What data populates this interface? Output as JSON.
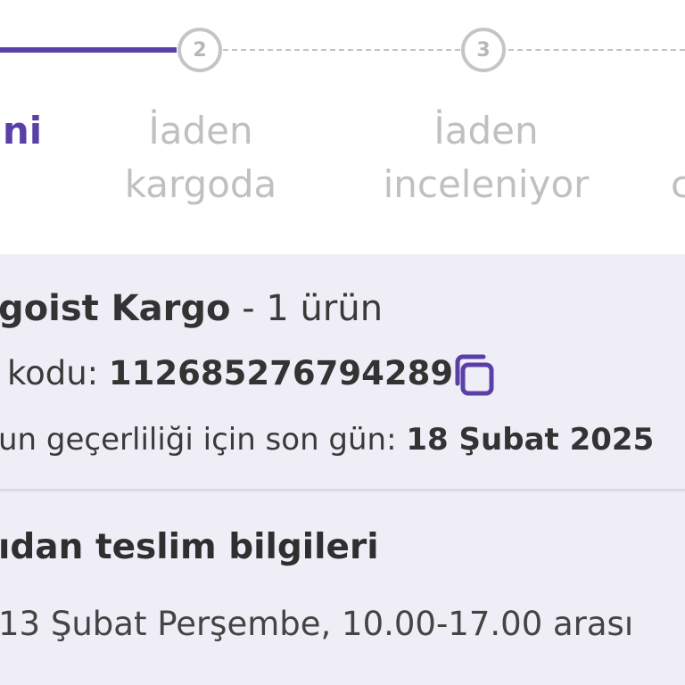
{
  "stepper": {
    "steps": [
      {
        "number": "",
        "label_lines": [
          "ni",
          ""
        ],
        "state": "active"
      },
      {
        "number": "2",
        "label_lines": [
          "İaden",
          "kargoda"
        ],
        "state": "pending"
      },
      {
        "number": "3",
        "label_lines": [
          "İaden",
          "inceleniyor"
        ],
        "state": "pending"
      },
      {
        "number": "",
        "label_lines": [
          "",
          "c"
        ],
        "state": "pending"
      }
    ]
  },
  "shipment": {
    "carrier": "goist Kargo",
    "separator": "-",
    "item_count": "1 ürün",
    "code_label": "kodu:",
    "code_value": "112685276794289",
    "validity_label": "un geçerliliği için son gün:",
    "validity_date": "18 Şubat 2025"
  },
  "delivery": {
    "heading": "ıdan teslim bilgileri",
    "detail": "13 Şubat Perşembe, 10.00-17.00 arası"
  },
  "colors": {
    "accent": "#5b3fa8",
    "inactive": "#c0c0c0",
    "panel_background": "#efedf6"
  },
  "icons": {
    "copy": "copy-icon"
  }
}
